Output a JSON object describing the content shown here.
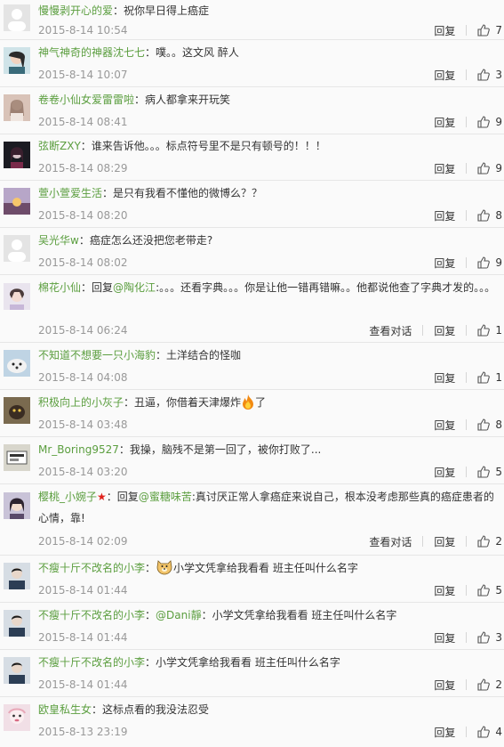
{
  "actions": {
    "reply": "回复",
    "view_conversation": "查看对话"
  },
  "comments": [
    {
      "user": "慢慢剥开心的爱",
      "colon": "：",
      "text": "祝你早日得上癌症",
      "time": "2015-8-14 10:54",
      "likes": "7"
    },
    {
      "user": "神气神奇的神器沈七七",
      "colon": "：",
      "text": "噗。。这文风 醉人",
      "time": "2015-8-14 10:07",
      "likes": "3"
    },
    {
      "user": "卷卷小仙女爱雷雷啦",
      "colon": "：",
      "text": "病人都拿来开玩笑",
      "time": "2015-8-14 08:41",
      "likes": "9"
    },
    {
      "user": "弦断ZXY",
      "colon": "：",
      "text": "谁来告诉他。。。标点符号里不是只有顿号的！！！",
      "time": "2015-8-14 08:29",
      "likes": "9"
    },
    {
      "user": "萱小萱爱生活",
      "colon": "：",
      "text": "是只有我看不懂他的微博么？？",
      "time": "2015-8-14 08:20",
      "likes": "8"
    },
    {
      "user": "吴光华w",
      "colon": "：",
      "text": "癌症怎么还没把您老带走?",
      "time": "2015-8-14 08:02",
      "likes": "9"
    },
    {
      "user": "棉花小仙",
      "colon": "：",
      "prefix": "回复",
      "mention": "@陶化江",
      "text": ":。。。还看字典。。。你是让他一错再错嘛。。他都说他查了字典才发的。。。",
      "time": "2015-8-14 06:24",
      "likes": "1"
    },
    {
      "user": "不知道不想要一只小海豹",
      "colon": "：",
      "text": "土洋结合的怪咖",
      "time": "2015-8-14 04:08",
      "likes": "1"
    },
    {
      "user": "积极向上的小灰子",
      "colon": "：",
      "text": "丑逼，你借着天津爆炸",
      "text_after": "了",
      "time": "2015-8-14 03:48",
      "likes": "8"
    },
    {
      "user": "Mr_Boring9527",
      "colon": "：",
      "text": "我操，脑残不是第一回了，被你打败了...",
      "time": "2015-8-14 03:20",
      "likes": "5"
    },
    {
      "user": "樱桃_小婉子",
      "badge": "★",
      "colon": "：",
      "prefix": "回复",
      "mention": "@蜜糖味苦",
      "text": ":真讨厌正常人拿癌症来说自己，根本没考虑那些真的癌症患者的心情，靠!",
      "time": "2015-8-14 02:09",
      "likes": "2"
    },
    {
      "user": "不瘦十斤不改名的小李",
      "colon": "：",
      "text": "小学文凭拿给我看看 班主任叫什么名字",
      "time": "2015-8-14 01:44",
      "likes": "5"
    },
    {
      "user": "不瘦十斤不改名的小李",
      "colon": "：",
      "mention": "@Dani靜",
      "text": "：小学文凭拿给我看看 班主任叫什么名字",
      "time": "2015-8-14 01:44",
      "likes": "3"
    },
    {
      "user": "不瘦十斤不改名的小李",
      "colon": "：",
      "text": "小学文凭拿给我看看 班主任叫什么名字",
      "time": "2015-8-14 01:44",
      "likes": "2"
    },
    {
      "user": "欧皇私生女",
      "colon": "：",
      "text": "这标点看的我没法忍受",
      "time": "2015-8-13 23:19",
      "likes": "4"
    }
  ]
}
